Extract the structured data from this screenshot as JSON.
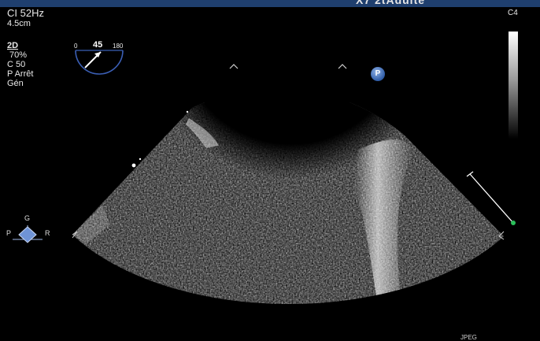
{
  "header": {
    "title": "X7 2tAdulte"
  },
  "acquisition": {
    "frequency": "CI 52Hz",
    "depth": "4.5cm",
    "mode": "2D",
    "gain": "70%",
    "compression": "C 50",
    "persistence": "P Arrêt",
    "preset": "Gén"
  },
  "multiplane_angle": {
    "min_label": "0",
    "value_label": "45",
    "max_label": "180",
    "value": 45
  },
  "probe": {
    "label": "C4"
  },
  "markers": {
    "p_badge": "P"
  },
  "orientation": {
    "top": "G",
    "left": "P",
    "right": "R"
  },
  "footer": {
    "corner_label": "JPEG"
  },
  "colors": {
    "top_bar": "#1f3f6e",
    "dial": "#3b5fb5",
    "p_badge": "#2f5ca6",
    "scale_dot": "#2bbf5a"
  },
  "icons": [
    "angle-dial-icon",
    "focus-marker-icon",
    "p-badge-icon",
    "orientation-diamond-icon",
    "depth-scale-icon",
    "grayscale-bar-icon"
  ]
}
